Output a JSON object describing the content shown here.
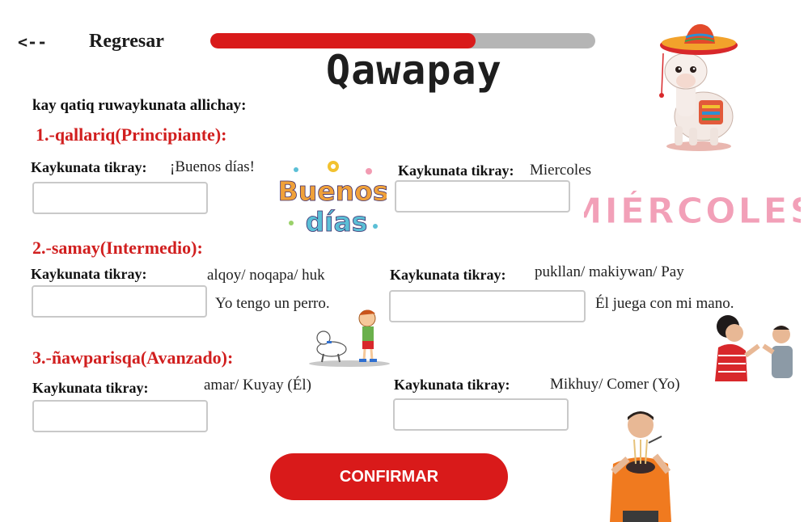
{
  "nav": {
    "back_arrow": "<--",
    "back_label": "Regresar"
  },
  "progress": {
    "value": 0.69,
    "fill_color": "#d91a1a",
    "track_color": "#b5b5b5"
  },
  "title": "Qawapay",
  "instructions": "kay qatiq ruwaykunata allichay:",
  "sections": [
    {
      "heading": "1.-qallariq(Principiante):",
      "exercises": [
        {
          "label": "Kaykunata tikray:",
          "hint": "¡Buenos días!",
          "value": ""
        },
        {
          "label": "Kaykunata tikray:",
          "hint": "Miercoles",
          "value": ""
        }
      ]
    },
    {
      "heading": "2.-samay(Intermedio):",
      "exercises": [
        {
          "label": "Kaykunata tikray:",
          "words": "alqoy/ noqapa/ huk",
          "sentence": "Yo tengo un perro.",
          "value": ""
        },
        {
          "label": "Kaykunata tikray:",
          "words": "pukllan/ makiywan/ Pay",
          "sentence": "Él juega con mi  mano.",
          "value": ""
        }
      ]
    },
    {
      "heading": "3.-ñawparisqa(Avanzado):",
      "exercises": [
        {
          "label": "Kaykunata tikray:",
          "hint": "amar/  Kuyay (Él)",
          "value": ""
        },
        {
          "label": "Kaykunata tikray:",
          "hint": "Mikhuy/ Comer (Yo)",
          "value": ""
        }
      ]
    }
  ],
  "confirm_label": "CONFIRMAR",
  "images": {
    "buenos_dias": {
      "line1": "Buenos",
      "line2": "días"
    },
    "miercoles": {
      "text": "MIÉRCOLES"
    }
  }
}
